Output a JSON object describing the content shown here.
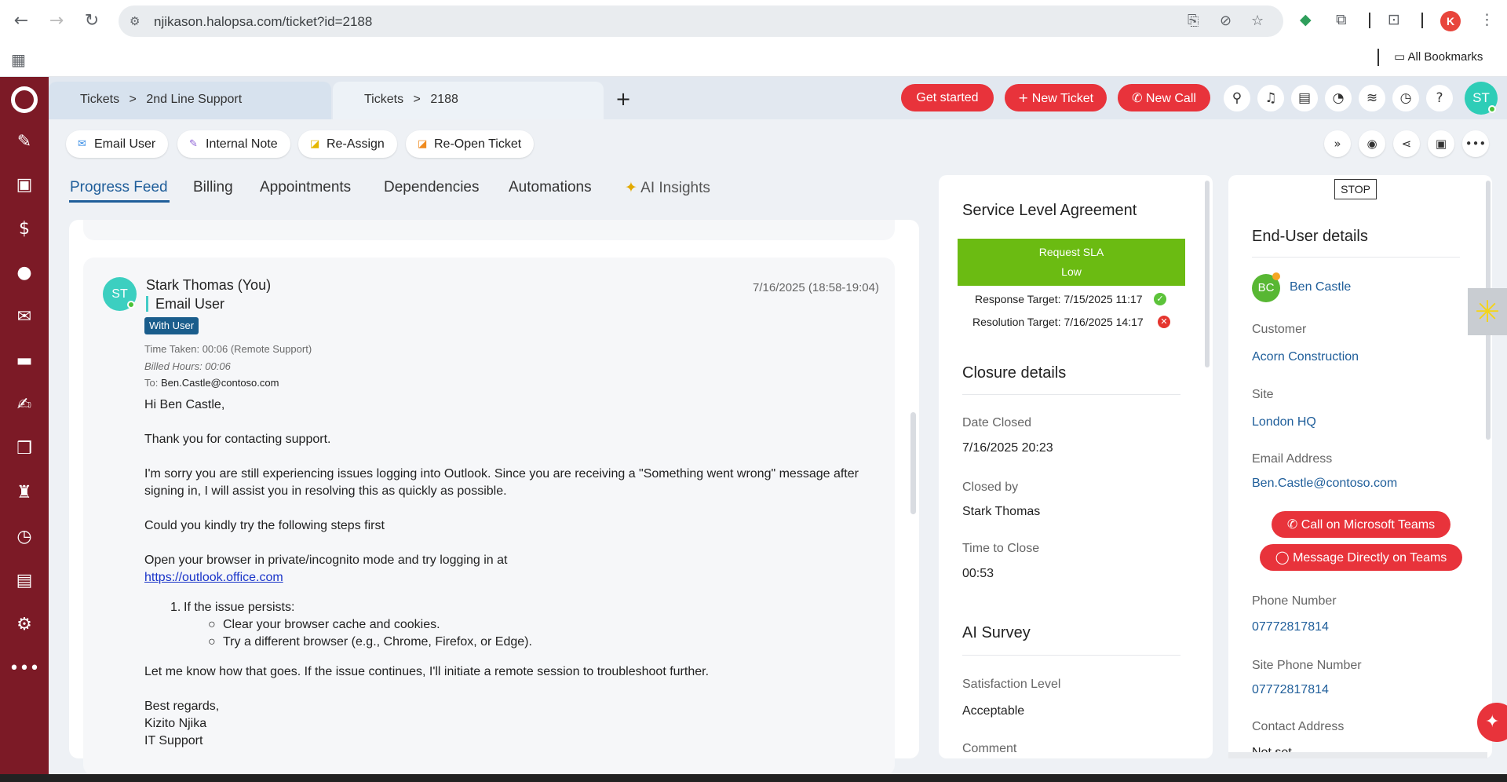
{
  "browser": {
    "url": "njikason.halopsa.com/ticket?id=2188",
    "profile_initial": "K",
    "bookmarks_label": "All Bookmarks"
  },
  "header": {
    "tabs": [
      {
        "crumb1": "Tickets",
        "sep": ">",
        "crumb2": "2nd Line Support"
      },
      {
        "crumb1": "Tickets",
        "sep": ">",
        "crumb2": "2188"
      }
    ],
    "get_started": "Get started",
    "new_ticket": "New Ticket",
    "new_call": "New Call",
    "user_initials": "ST"
  },
  "actions": {
    "email_user": "Email User",
    "internal_note": "Internal Note",
    "reassign": "Re-Assign",
    "reopen": "Re-Open Ticket"
  },
  "content_tabs": [
    "Progress Feed",
    "Billing",
    "Appointments",
    "Dependencies",
    "Automations",
    "AI Insights"
  ],
  "post": {
    "initials": "ST",
    "author": "Stark Thomas (You)",
    "type": "Email User",
    "badge": "With User",
    "date": "7/16/2025 (18:58-19:04)",
    "time_taken": "Time Taken: 00:06 (Remote Support)",
    "billed_hours": "Billed Hours: 00:06",
    "to_label": "To:",
    "to_value": "Ben.Castle@contoso.com",
    "greeting": "Hi Ben Castle,",
    "p1": "Thank you for contacting support.",
    "p2a": "I'm sorry you are still experiencing issues logging into Outlook. Since you are receiving a \"Something went wrong\" message after",
    "p2b": "signing in, I will assist you in resolving this as quickly as possible.",
    "p3": "Could you kindly try the following steps first",
    "p4": "Open your browser in private/incognito mode and try logging in at",
    "link": "https://outlook.office.com",
    "list_num": "1.",
    "list_item": "If the issue persists:",
    "sub1": "Clear your browser cache and cookies.",
    "sub2": "Try a different browser (e.g., Chrome, Firefox, or Edge).",
    "p5": "Let me know how that goes. If the issue continues, I'll initiate a remote session to troubleshoot further.",
    "sign1": "Best regards,",
    "sign2": "Kizito Njika",
    "sign3": "IT Support"
  },
  "sla": {
    "title": "Service Level Agreement",
    "bar_line1": "Request SLA",
    "bar_line2": "Low",
    "bar_color": "#6bbb12",
    "response": "Response Target: 7/15/2025 11:17",
    "resolution": "Resolution Target: 7/16/2025 14:17"
  },
  "closure": {
    "title": "Closure details",
    "date_closed_label": "Date Closed",
    "date_closed": "7/16/2025 20:23",
    "closed_by_label": "Closed by",
    "closed_by": "Stark Thomas",
    "time_to_close_label": "Time to Close",
    "time_to_close": "00:53"
  },
  "survey": {
    "title": "AI Survey",
    "satisfaction_label": "Satisfaction Level",
    "satisfaction": "Acceptable",
    "comment_label": "Comment"
  },
  "enduser": {
    "stop": "STOP",
    "title": "End-User details",
    "initials": "BC",
    "name": "Ben Castle",
    "customer_label": "Customer",
    "customer": "Acorn Construction",
    "site_label": "Site",
    "site": "London HQ",
    "email_label": "Email Address",
    "email": "Ben.Castle@contoso.com",
    "call_teams": "Call on Microsoft Teams",
    "message_teams": "Message Directly on Teams",
    "phone_label": "Phone Number",
    "phone": "07772817814",
    "site_phone_label": "Site Phone Number",
    "site_phone": "07772817814",
    "contact_address_label": "Contact Address",
    "contact_address": "Not set"
  },
  "colors": {
    "rail": "#7c1a26",
    "accent_red": "#e8333b",
    "link_blue": "#1f5e9a"
  }
}
